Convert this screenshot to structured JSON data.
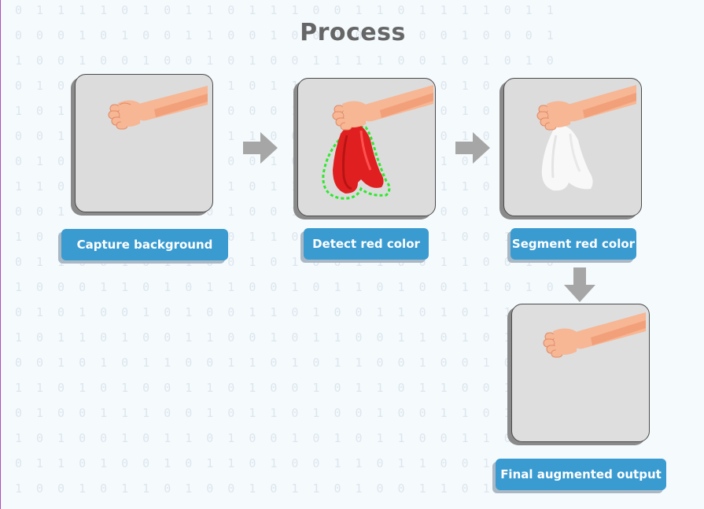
{
  "title": "Process",
  "steps": [
    {
      "label": "Capture background",
      "cloth": "none"
    },
    {
      "label": "Detect red color",
      "cloth": "red-outlined"
    },
    {
      "label": "Segment red color",
      "cloth": "white"
    },
    {
      "label": "Final augmented output",
      "cloth": "none"
    }
  ],
  "icons": [
    "hand-icon",
    "red-cloth-icon",
    "white-cloth-icon",
    "right-arrow-icon",
    "down-arrow-icon"
  ],
  "colors": {
    "label_bg": "#3a9bd1",
    "card_bg": "#dcdcdc",
    "arrow": "#a6a6a6",
    "cloth_red": "#e02020",
    "outline_green": "#2ee82e",
    "skin": "#f7b694",
    "title": "#666666"
  },
  "background_pattern": [
    "0 1 1 1 1 0 1 0 1 1 0 1 1 1 0 0 1 1 0 1 1 1 1 0 1 1",
    "0 0 0 1 0 1 0 0 1 1 0 0 1 0 0 1 0 1 0 0 0 1 0 0 0 1",
    "1 0 0 1 0 0 1 0 0 1 0 1 0 0 1 1 1 1 0 0 1 0 1 0 1 0",
    "0 1 0 0 1 1 0 1 0 0 1 0 1 1 0 0 1 0 0 1 0 1 0 1 0 1",
    "1 0 1 0 0 0 1 1 0 1 0 0 0 1 1 0 1 1 0 1 0 1 0 1 1 0",
    "0 0 1 1 0 1 0 0 1 0 1 1 0 0 1 0 0 0 1 1 0 1 0 0 1 1",
    "0 1 0 0 0 1 1 0 1 1 0 0 1 0 1 1 0 1 0 0 1 0 1 0 1 0",
    "1 1 0 1 0 0 0 1 0 0 1 0 1 1 0 1 0 0 1 0 1 1 0 1 0 1",
    "0 0 1 0 1 1 0 0 1 0 1 0 0 1 1 0 1 0 1 1 0 0 1 0 1 1",
    "1 0 0 1 1 0 1 0 0 1 0 1 1 0 0 1 0 1 1 0 1 0 0 1 0 1",
    "0 1 1 0 0 1 0 1 1 0 0 1 0 1 0 0 1 1 0 0 1 1 0 0 1 0",
    "1 0 0 0 1 1 0 1 0 1 1 0 0 1 0 1 1 0 1 0 0 1 1 0 1 0",
    "0 1 0 1 0 0 1 0 1 0 0 1 1 0 1 0 0 1 1 0 1 0 1 1 0 1",
    "1 0 1 1 0 1 0 0 1 1 0 0 1 0 1 1 0 0 1 1 0 1 0 1 1 0",
    "0 0 1 0 1 0 1 1 0 0 1 1 0 1 0 1 1 0 0 1 0 0 1 0 1 1",
    "1 1 0 1 0 1 0 0 1 1 0 1 0 0 1 0 1 1 0 1 1 0 0 1 0 1",
    "0 1 0 0 1 1 1 0 0 1 0 1 1 0 1 0 0 1 0 0 1 1 0 1 1 0",
    "1 0 1 0 0 1 0 1 1 0 1 0 0 1 0 1 0 1 1 0 0 1 1 0 0 1",
    "0 1 1 0 1 0 0 1 0 1 1 0 1 0 0 1 1 0 1 1 0 0 1 1 0 1",
    "1 0 0 1 0 1 1 0 1 0 0 1 0 1 1 0 1 0 0 1 1 0 1 0 1 0"
  ]
}
